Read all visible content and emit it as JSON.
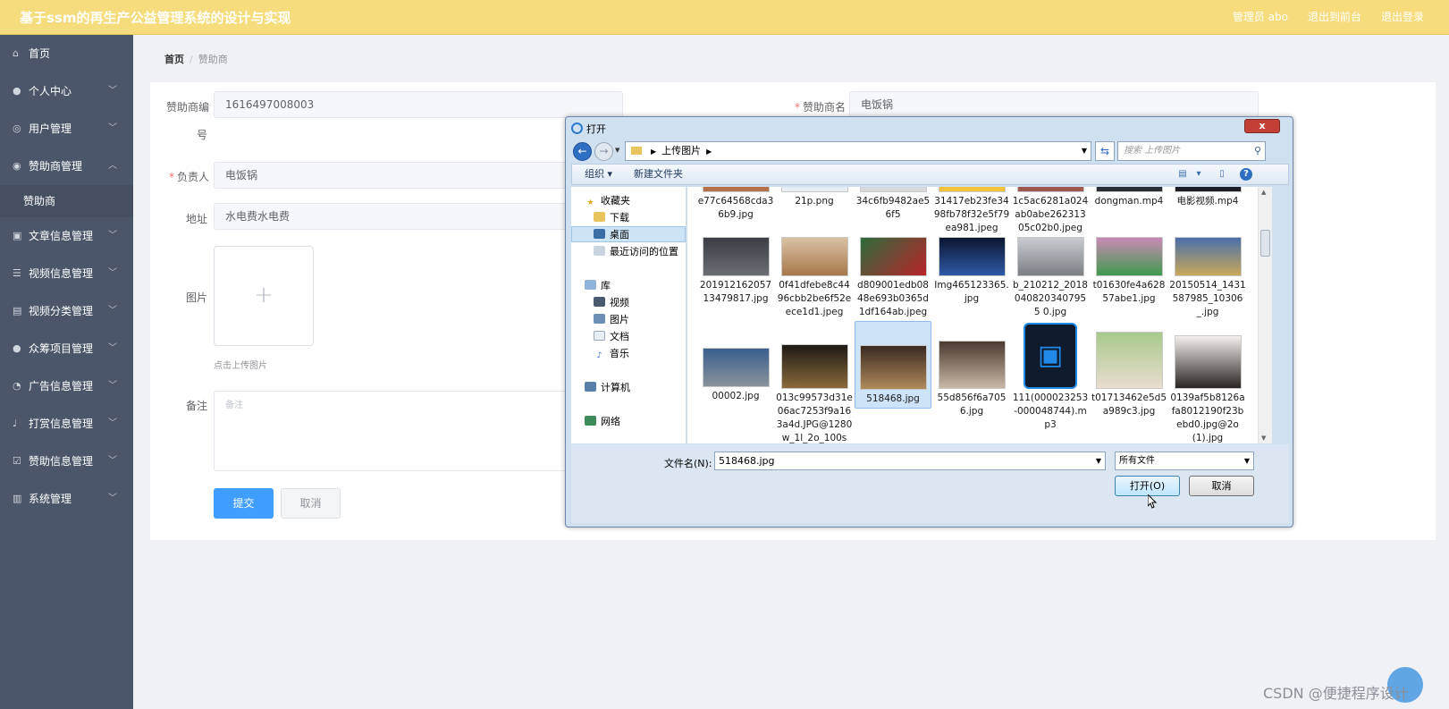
{
  "header": {
    "title": "基于ssm的再生产公益管理系统的设计与实现",
    "user": "管理员 abo",
    "to_front": "退出到前台",
    "logout": "退出登录"
  },
  "sidebar": {
    "items": [
      {
        "label": "首页",
        "icon": "home-icon"
      },
      {
        "label": "个人中心",
        "icon": "user-icon"
      },
      {
        "label": "用户管理",
        "icon": "globe-icon"
      },
      {
        "label": "赞助商管理",
        "icon": "location-icon"
      },
      {
        "label": "赞助商",
        "icon": ""
      },
      {
        "label": "文章信息管理",
        "icon": "suitcase-icon"
      },
      {
        "label": "视频信息管理",
        "icon": "list-icon"
      },
      {
        "label": "视频分类管理",
        "icon": "clipboard-icon"
      },
      {
        "label": "众筹项目管理",
        "icon": "user-icon"
      },
      {
        "label": "广告信息管理",
        "icon": "compass-icon"
      },
      {
        "label": "打赏信息管理",
        "icon": "microphone-icon"
      },
      {
        "label": "赞助信息管理",
        "icon": "checkbox-icon"
      },
      {
        "label": "系统管理",
        "icon": "chart-icon"
      }
    ]
  },
  "breadcrumb": {
    "home": "首页",
    "sep": "/",
    "current": "赞助商"
  },
  "form": {
    "sponsor_no_label_1": "赞助商编",
    "sponsor_no_label_2": "号",
    "sponsor_no_value": "1616497008003",
    "sponsor_name_label": "赞助商名",
    "sponsor_name_value": "电饭锅",
    "owner_label": "负责人",
    "owner_value": "电饭锅",
    "address_label": "地址",
    "address_value": "水电费水电费",
    "image_label": "图片",
    "upload_hint": "点击上传图片",
    "remark_label": "备注",
    "remark_placeholder": "备注",
    "required_mark": "*",
    "plus": "+",
    "submit": "提交",
    "cancel": "取消"
  },
  "dialog": {
    "title": "打开",
    "close": "x",
    "path": "上传图片",
    "search_placeholder": "搜索 上传图片",
    "organize": "组织 ▾",
    "new_folder": "新建文件夹",
    "nav": {
      "favorites": "收藏夹",
      "downloads": "下载",
      "desktop": "桌面",
      "recent": "最近访问的位置",
      "libraries": "库",
      "videos": "视频",
      "pictures": "图片",
      "documents": "文档",
      "music": "音乐",
      "computer": "计算机",
      "network": "网络"
    },
    "files": [
      "e77c64568cda36b9.jpg",
      "21p.png",
      "34c6fb9482ae56f5",
      "31417eb23fe3498fb78f32e5f79ea981.jpeg",
      "1c5ac6281a024ab0abe26231305c02b0.jpeg",
      "dongman.mp4",
      "电影视频.mp4",
      "20191216205713479817.jpg",
      "0f41dfebe8c4496cbb2be6f52eece1d1.jpeg",
      "d809001edb0848e693b0365d1df164ab.jpeg",
      "Img465123365.jpg",
      "b_210212_20180408203407955 0.jpg",
      "t01630fe4a62857abe1.jpg",
      "20150514_1431587985_10306_.jpg",
      "00002.jpg",
      "013c99573d31e06ac7253f9a163a4d.JPG@1280w_1l_2o_100sh...",
      "518468.jpg",
      "55d856f6a7056.jpg",
      "111(000023253-000048744).mp3",
      "t01713462e5d5a989c3.jpg",
      "0139af5b8126afa8012190f23bebd0.jpg@2o(1).jpg"
    ],
    "filename_label": "文件名(N):",
    "filename_value": "518468.jpg",
    "filetype_value": "所有文件",
    "open": "打开(O)",
    "cancel": "取消"
  },
  "watermark": "CSDN @便捷程序设计"
}
